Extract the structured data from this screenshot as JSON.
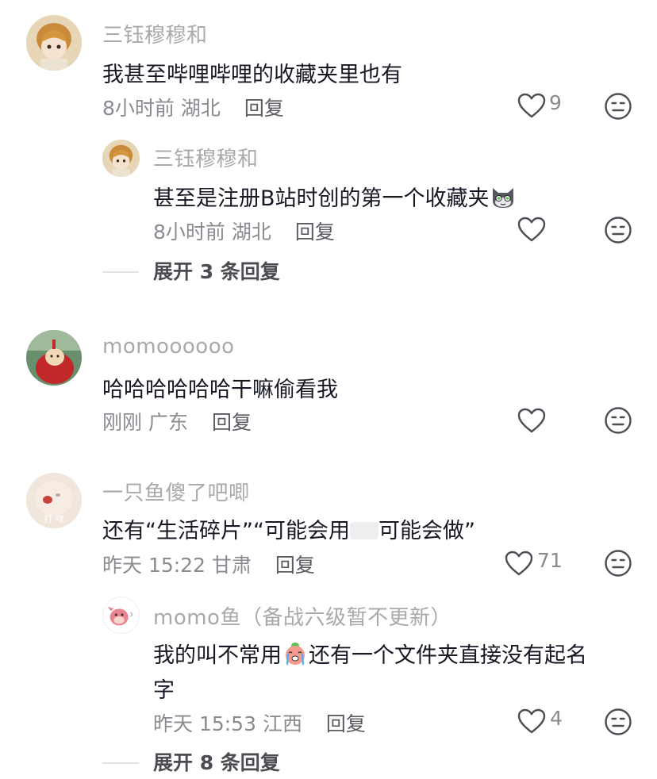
{
  "comments": [
    {
      "user": "三钰穆穆和",
      "text": "我甚至哔哩哔哩的收藏夹里也有",
      "time": "8小时前",
      "location": "湖北",
      "reply_label": "回复",
      "likes": "9",
      "reply": {
        "user": "三钰穆穆和",
        "text": "甚至是注册B站时创的第一个收藏夹",
        "time": "8小时前",
        "location": "湖北",
        "reply_label": "回复",
        "likes": ""
      },
      "expand_label": "展开 3 条回复"
    },
    {
      "user": "momoooooo",
      "text": "哈哈哈哈哈哈干嘛偷看我",
      "time": "刚刚",
      "location": "广东",
      "reply_label": "回复",
      "likes": ""
    },
    {
      "user": "一只鱼傻了吧唧",
      "avatar_text": "打 咩",
      "text_part1": "还有“生活碎片”“可能会用",
      "text_part2": "可能会做”",
      "time": "昨天 15:22",
      "location": "甘肃",
      "reply_label": "回复",
      "likes": "71",
      "reply": {
        "user": "momo鱼（备战六级暂不更新）",
        "text_part1": "我的叫不常用",
        "text_part2": "还有一个文件夹直接没有起名",
        "text_line2": "字",
        "time": "昨天 15:53",
        "location": "江西",
        "reply_label": "回复",
        "likes": "4"
      },
      "expand_label": "展开 8 条回复"
    }
  ],
  "icons": {
    "like": "heart-outline-icon",
    "dislike": "expressionless-face-icon",
    "cat_emoji": "cat-face-emoji",
    "crying_emoji": "crying-face-emoji"
  },
  "colors": {
    "username": "#a9a9ad",
    "meta": "#8a8b91",
    "text": "#161823"
  }
}
